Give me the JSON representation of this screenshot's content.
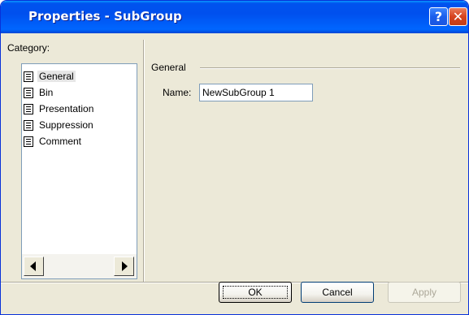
{
  "window": {
    "title": "Properties - SubGroup",
    "help_glyph": "?",
    "close_glyph": "✕"
  },
  "category": {
    "label": "Category:",
    "items": [
      {
        "label": "General",
        "icon": "property-page-icon",
        "selected": true
      },
      {
        "label": "Bin",
        "icon": "property-page-icon",
        "selected": false
      },
      {
        "label": "Presentation",
        "icon": "property-page-icon",
        "selected": false
      },
      {
        "label": "Suppression",
        "icon": "property-page-icon",
        "selected": false
      },
      {
        "label": "Comment",
        "icon": "property-page-icon",
        "selected": false
      }
    ]
  },
  "general": {
    "group_label": "General",
    "name_label": "Name:",
    "name_value": "NewSubGroup 1"
  },
  "buttons": {
    "ok": "OK",
    "cancel": "Cancel",
    "apply": "Apply"
  },
  "colors": {
    "title_bar": "#0054e3",
    "dialog_bg": "#ece9d8",
    "close_button": "#d6431f",
    "disabled_text": "#aca899"
  }
}
